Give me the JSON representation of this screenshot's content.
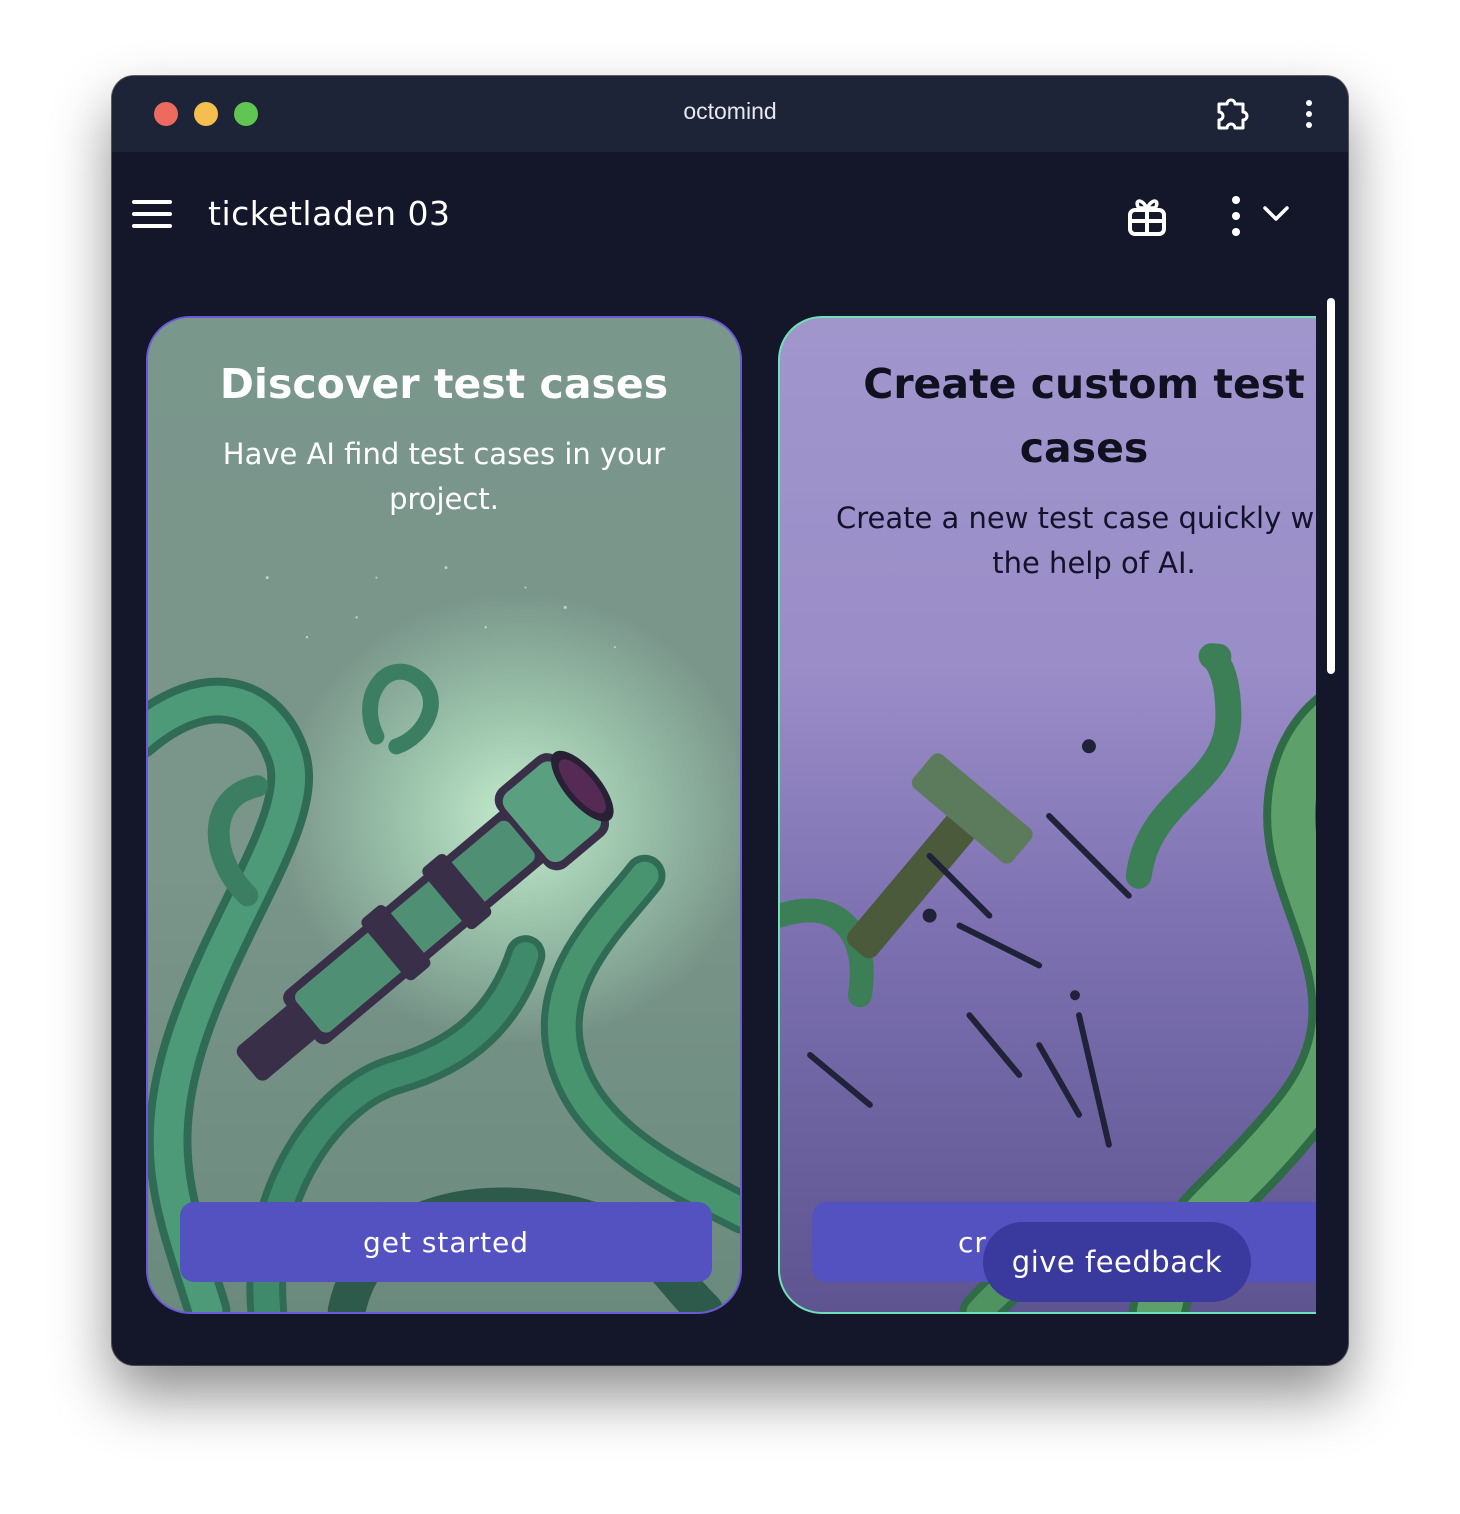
{
  "window": {
    "title": "octomind"
  },
  "appbar": {
    "project_name": "ticketladen 03"
  },
  "cards": [
    {
      "title": "Discover test cases",
      "subtitle": "Have AI find test cases in your project.",
      "button_label": "get started",
      "illustration": "octopus-tentacles-with-telescope"
    },
    {
      "title": "Create custom test cases",
      "subtitle": "Create a new test case quickly with the help of AI.",
      "button_label_visible": "cr",
      "illustration": "octopus-tentacles-with-tools"
    }
  ],
  "feedback": {
    "label": "give feedback"
  },
  "colors": {
    "titlebar": "#1d2438",
    "background": "#14162a",
    "button": "#5451c0",
    "feedback_button": "#3a3a9e",
    "card1_bg": "#7a978c",
    "card2_bg": "#a096cc",
    "card_border_green": "#6fe0b7",
    "card_border_purple": "#6b59d6"
  },
  "icons": {
    "menu": "hamburger-icon",
    "extension": "puzzle-piece-icon",
    "window_menu": "kebab-vertical-icon",
    "gift": "gift-icon",
    "app_menu": "kebab-vertical-icon",
    "dropdown": "chevron-down-icon"
  }
}
